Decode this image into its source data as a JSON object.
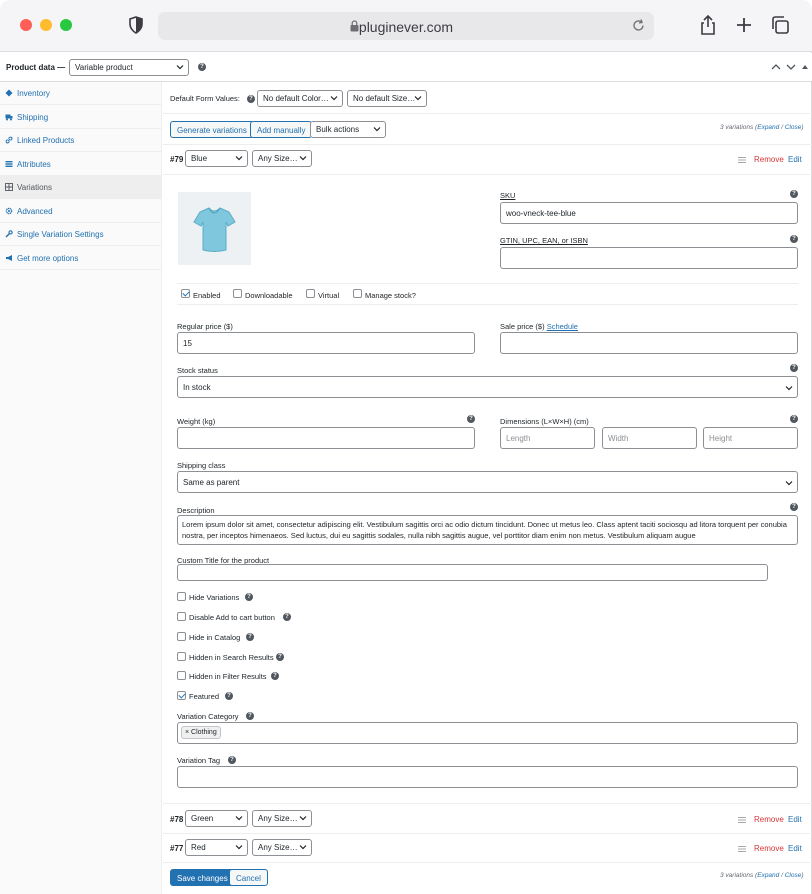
{
  "browser": {
    "url": "pluginever.com"
  },
  "product_data": {
    "label": "Product data —",
    "type_select": "Variable product"
  },
  "sidebar": {
    "items": [
      {
        "label": "Inventory",
        "icon": "diamond-icon"
      },
      {
        "label": "Shipping",
        "icon": "truck-icon"
      },
      {
        "label": "Linked Products",
        "icon": "link-icon"
      },
      {
        "label": "Attributes",
        "icon": "list-icon"
      },
      {
        "label": "Variations",
        "icon": "grid-icon"
      },
      {
        "label": "Advanced",
        "icon": "gear-icon"
      },
      {
        "label": "Single Variation Settings",
        "icon": "wrench-icon"
      },
      {
        "label": "Get more options",
        "icon": "megaphone-icon"
      }
    ]
  },
  "defaults": {
    "label": "Default Form Values:",
    "color": "No default Color…",
    "size": "No default Size…"
  },
  "toolbar": {
    "generate": "Generate variations",
    "add_manually": "Add manually",
    "bulk": "Bulk actions",
    "count": "3 variations",
    "expand": "Expand",
    "sep": " / ",
    "close": "Close"
  },
  "variations": [
    {
      "id": "#79",
      "color": "Blue",
      "size": "Any Size…",
      "remove": "Remove",
      "edit": "Edit"
    },
    {
      "id": "#78",
      "color": "Green",
      "size": "Any Size…",
      "remove": "Remove",
      "edit": "Edit"
    },
    {
      "id": "#77",
      "color": "Red",
      "size": "Any Size…",
      "remove": "Remove",
      "edit": "Edit"
    }
  ],
  "form": {
    "sku_label": "SKU",
    "sku_value": "woo-vneck-tee-blue",
    "gtin_label": "GTIN, UPC, EAN, or ISBN",
    "enabled": "Enabled",
    "downloadable": "Downloadable",
    "virtual": "Virtual",
    "manage_stock": "Manage stock?",
    "regular_price_label": "Regular price ($)",
    "regular_price": "15",
    "sale_price_label": "Sale price ($)",
    "schedule": "Schedule",
    "stock_status_label": "Stock status",
    "stock_status": "In stock",
    "weight_label": "Weight (kg)",
    "dimensions_label": "Dimensions (L×W×H) (cm)",
    "length_ph": "Length",
    "width_ph": "Width",
    "height_ph": "Height",
    "shipping_class_label": "Shipping class",
    "shipping_class": "Same as parent",
    "description_label": "Description",
    "description": "Lorem ipsum dolor sit amet, consectetur adipiscing elit. Vestibulum sagittis orci ac odio dictum tincidunt. Donec ut metus leo. Class aptent taciti sociosqu ad litora torquent per conubia nostra, per inceptos himenaeos. Sed luctus, dui eu sagittis sodales, nulla nibh sagittis augue, vel porttitor diam enim non metus. Vestibulum aliquam augue",
    "custom_title_label": "Custom Title for the product",
    "hide_variations": "Hide Variations",
    "disable_cart": "Disable Add to cart button",
    "hide_catalog": "Hide in Catalog",
    "hidden_search": "Hidden in Search Results",
    "hidden_filter": "Hidden in Filter Results",
    "featured": "Featured",
    "variation_category_label": "Variation Category",
    "category_tag": "× Clothing",
    "variation_tag_label": "Variation Tag"
  },
  "footer": {
    "save": "Save changes",
    "cancel": "Cancel"
  }
}
